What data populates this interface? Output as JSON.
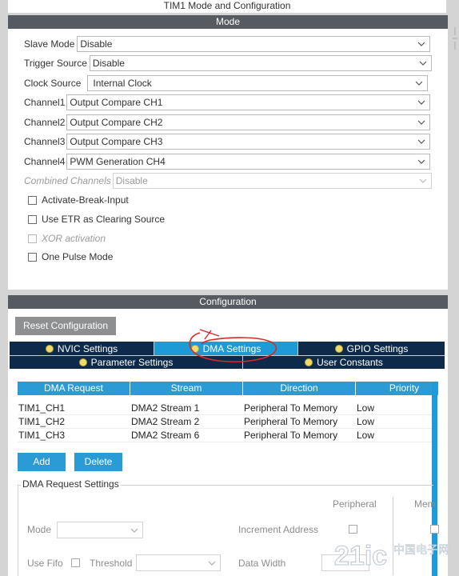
{
  "window_title": "TIM1 Mode and Configuration",
  "mode": {
    "header": "Mode",
    "fields": [
      {
        "label": "Slave Mode",
        "value": "Disable",
        "enabled": true
      },
      {
        "label": "Trigger Source",
        "value": "Disable",
        "enabled": true
      },
      {
        "label": "Clock Source",
        "value": "Internal Clock",
        "enabled": true
      },
      {
        "label": "Channel1",
        "value": "Output Compare CH1",
        "enabled": true
      },
      {
        "label": "Channel2",
        "value": "Output Compare CH2",
        "enabled": true
      },
      {
        "label": "Channel3",
        "value": "Output Compare CH3",
        "enabled": true
      },
      {
        "label": "Channel4",
        "value": "PWM Generation CH4",
        "enabled": true
      },
      {
        "label": "Combined Channels",
        "value": "Disable",
        "enabled": false
      }
    ],
    "checkboxes": [
      {
        "label": "Activate-Break-Input",
        "checked": false,
        "enabled": true
      },
      {
        "label": "Use ETR as Clearing Source",
        "checked": false,
        "enabled": true
      },
      {
        "label": "XOR activation",
        "checked": false,
        "enabled": false
      },
      {
        "label": "One Pulse Mode",
        "checked": false,
        "enabled": true
      }
    ]
  },
  "configuration": {
    "header": "Configuration",
    "reset_label": "Reset Configuration",
    "tabs_row1": [
      {
        "label": "NVIC Settings",
        "active": false
      },
      {
        "label": "DMA Settings",
        "active": true
      },
      {
        "label": "GPIO Settings",
        "active": false
      }
    ],
    "tabs_row2": [
      {
        "label": "Parameter Settings",
        "active": false
      },
      {
        "label": "User Constants",
        "active": false
      }
    ],
    "table": {
      "columns": [
        "DMA Request",
        "Stream",
        "Direction",
        "Priority"
      ],
      "rows": [
        [
          "TIM1_CH1",
          "DMA2 Stream 1",
          "Peripheral To Memory",
          "Low"
        ],
        [
          "TIM1_CH2",
          "DMA2 Stream 2",
          "Peripheral To Memory",
          "Low"
        ],
        [
          "TIM1_CH3",
          "DMA2 Stream 6",
          "Peripheral To Memory",
          "Low"
        ]
      ]
    },
    "add_label": "Add",
    "delete_label": "Delete",
    "dma_request_settings": {
      "legend": "DMA Request Settings",
      "peripheral_header": "Peripheral",
      "memory_header": "Mem",
      "mode_label": "Mode",
      "increment_address_label": "Increment Address",
      "use_fifo_label": "Use Fifo",
      "threshold_label": "Threshold",
      "data_width_label": "Data Width"
    }
  },
  "watermark": {
    "text_main": "21ic",
    "text_cn": "中国电子网"
  },
  "colors": {
    "header_bg": "#555b60",
    "tab_bg": "#0e2a4a",
    "tab_active": "#1e9ad6",
    "table_header": "#2b9bd6",
    "annotation": "#d62a2a"
  }
}
